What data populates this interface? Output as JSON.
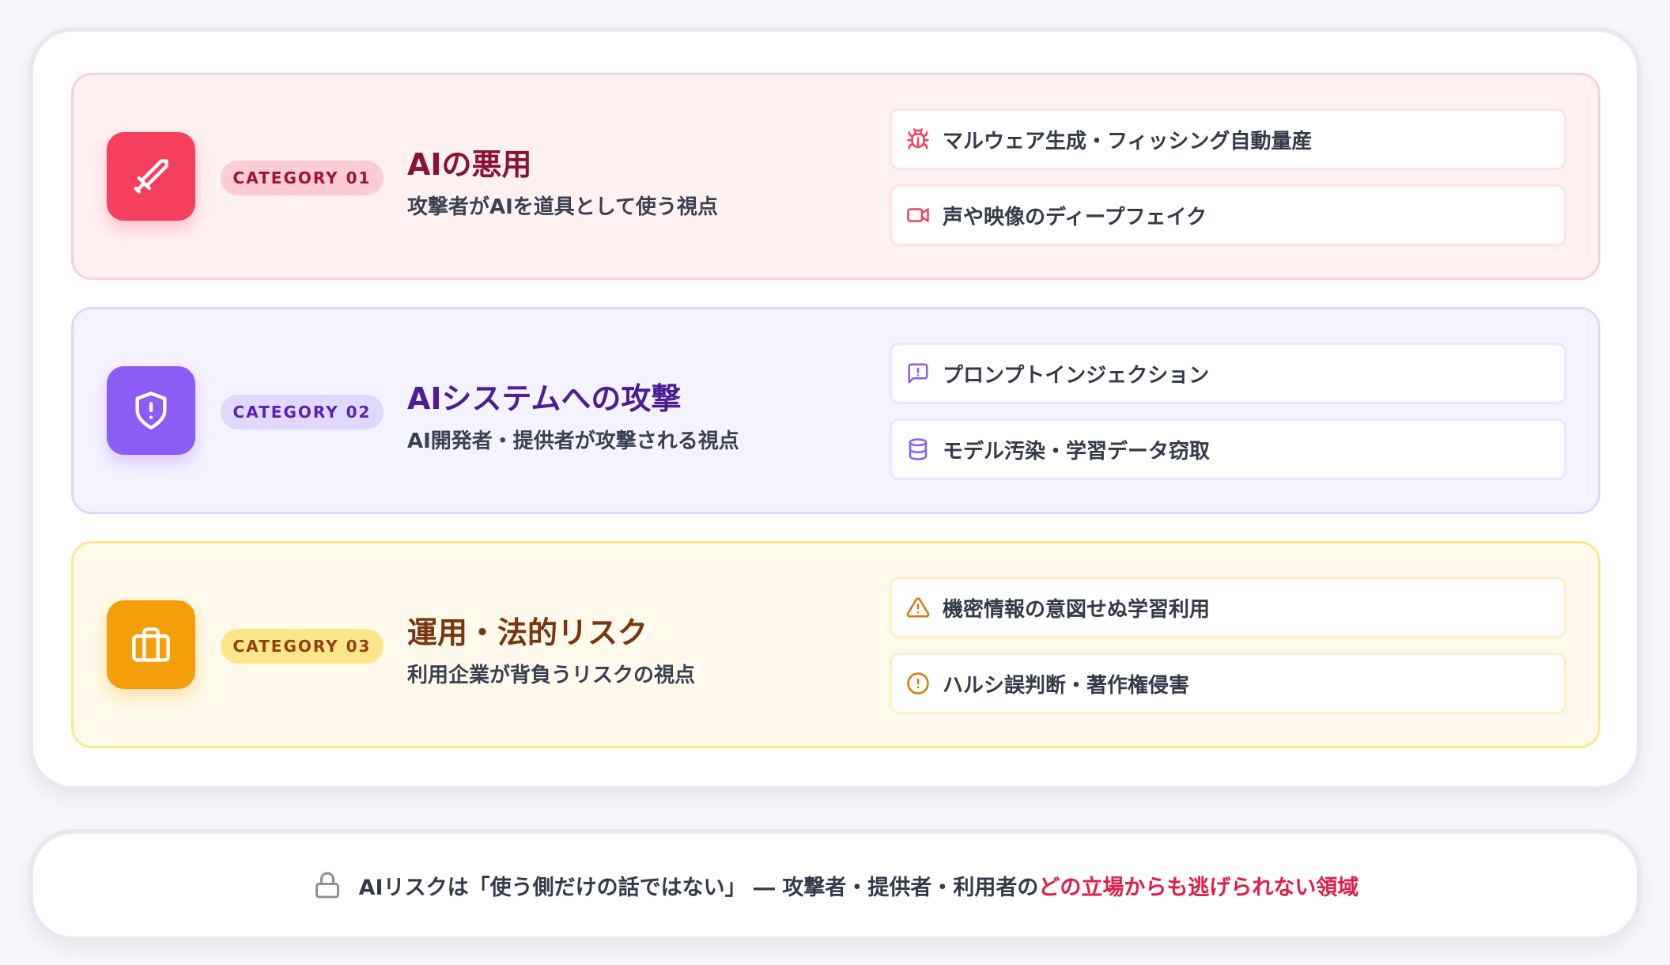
{
  "categories": [
    {
      "badge": "CATEGORY 01",
      "title": "AIの悪用",
      "subtitle": "攻撃者がAIを道具として使う視点",
      "icon": "sword-icon",
      "accent": "#f43f5e",
      "items": [
        {
          "icon": "bug-icon",
          "label": "マルウェア生成・フィッシング自動量産"
        },
        {
          "icon": "video-icon",
          "label": "声や映像のディープフェイク"
        }
      ]
    },
    {
      "badge": "CATEGORY 02",
      "title": "AIシステムへの攻撃",
      "subtitle": "AI開発者・提供者が攻撃される視点",
      "icon": "shield-alert-icon",
      "accent": "#8b5cf6",
      "items": [
        {
          "icon": "message-alert-icon",
          "label": "プロンプトインジェクション"
        },
        {
          "icon": "database-icon",
          "label": "モデル汚染・学習データ窃取"
        }
      ]
    },
    {
      "badge": "CATEGORY 03",
      "title": "運用・法的リスク",
      "subtitle": "利用企業が背負うリスクの視点",
      "icon": "briefcase-icon",
      "accent": "#f59e0b",
      "items": [
        {
          "icon": "warning-triangle-icon",
          "label": "機密情報の意図せぬ学習利用"
        },
        {
          "icon": "alert-circle-icon",
          "label": "ハルシ誤判断・著作権侵害"
        }
      ]
    }
  ],
  "footer": {
    "icon": "lock-icon",
    "text": "AIリスクは「使う側だけの話ではない」 ― 攻撃者・提供者・利用者の",
    "highlight": "どの立場からも逃げられない領域",
    "highlight_color": "#e11d48"
  }
}
